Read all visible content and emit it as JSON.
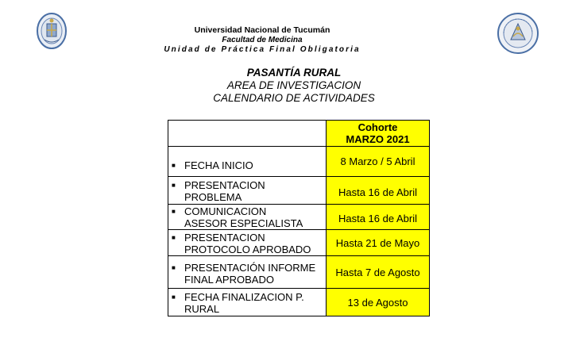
{
  "header": {
    "university": "Universidad Nacional de Tucumán",
    "faculty": "Facultad de Medicina",
    "unit": "Unidad de Práctica Final Obligatoria"
  },
  "title": {
    "line1": "PASANTÍA RURAL",
    "line2": "AREA DE INVESTIGACION",
    "line3": "CALENDARIO DE ACTIVIDADES"
  },
  "table": {
    "header_col2_line1": "Cohorte",
    "header_col2_line2": "MARZO 2021",
    "rows": [
      {
        "activity": "FECHA INICIO",
        "date": "8 Marzo / 5 Abril"
      },
      {
        "activity": "PRESENTACION\nPROBLEMA",
        "date": "Hasta 16 de Abril"
      },
      {
        "activity": "COMUNICACION\n ASESOR ESPECIALISTA",
        "date": "Hasta 16 de Abril"
      },
      {
        "activity": "PRESENTACION\nPROTOCOLO APROBADO",
        "date": "Hasta 21 de Mayo"
      },
      {
        "activity": "PRESENTACIÓN INFORME\nFINAL APROBADO",
        "date": "Hasta 7 de Agosto"
      },
      {
        "activity": "FECHA FINALIZACION P.\nRURAL",
        "date": "13 de Agosto"
      }
    ]
  },
  "colors": {
    "highlight": "#ffff00",
    "seal_blue": "#4a6fa5",
    "seal_gold": "#c9a94a"
  },
  "icons": {
    "left": "university-seal-icon",
    "right": "faculty-seal-icon"
  }
}
